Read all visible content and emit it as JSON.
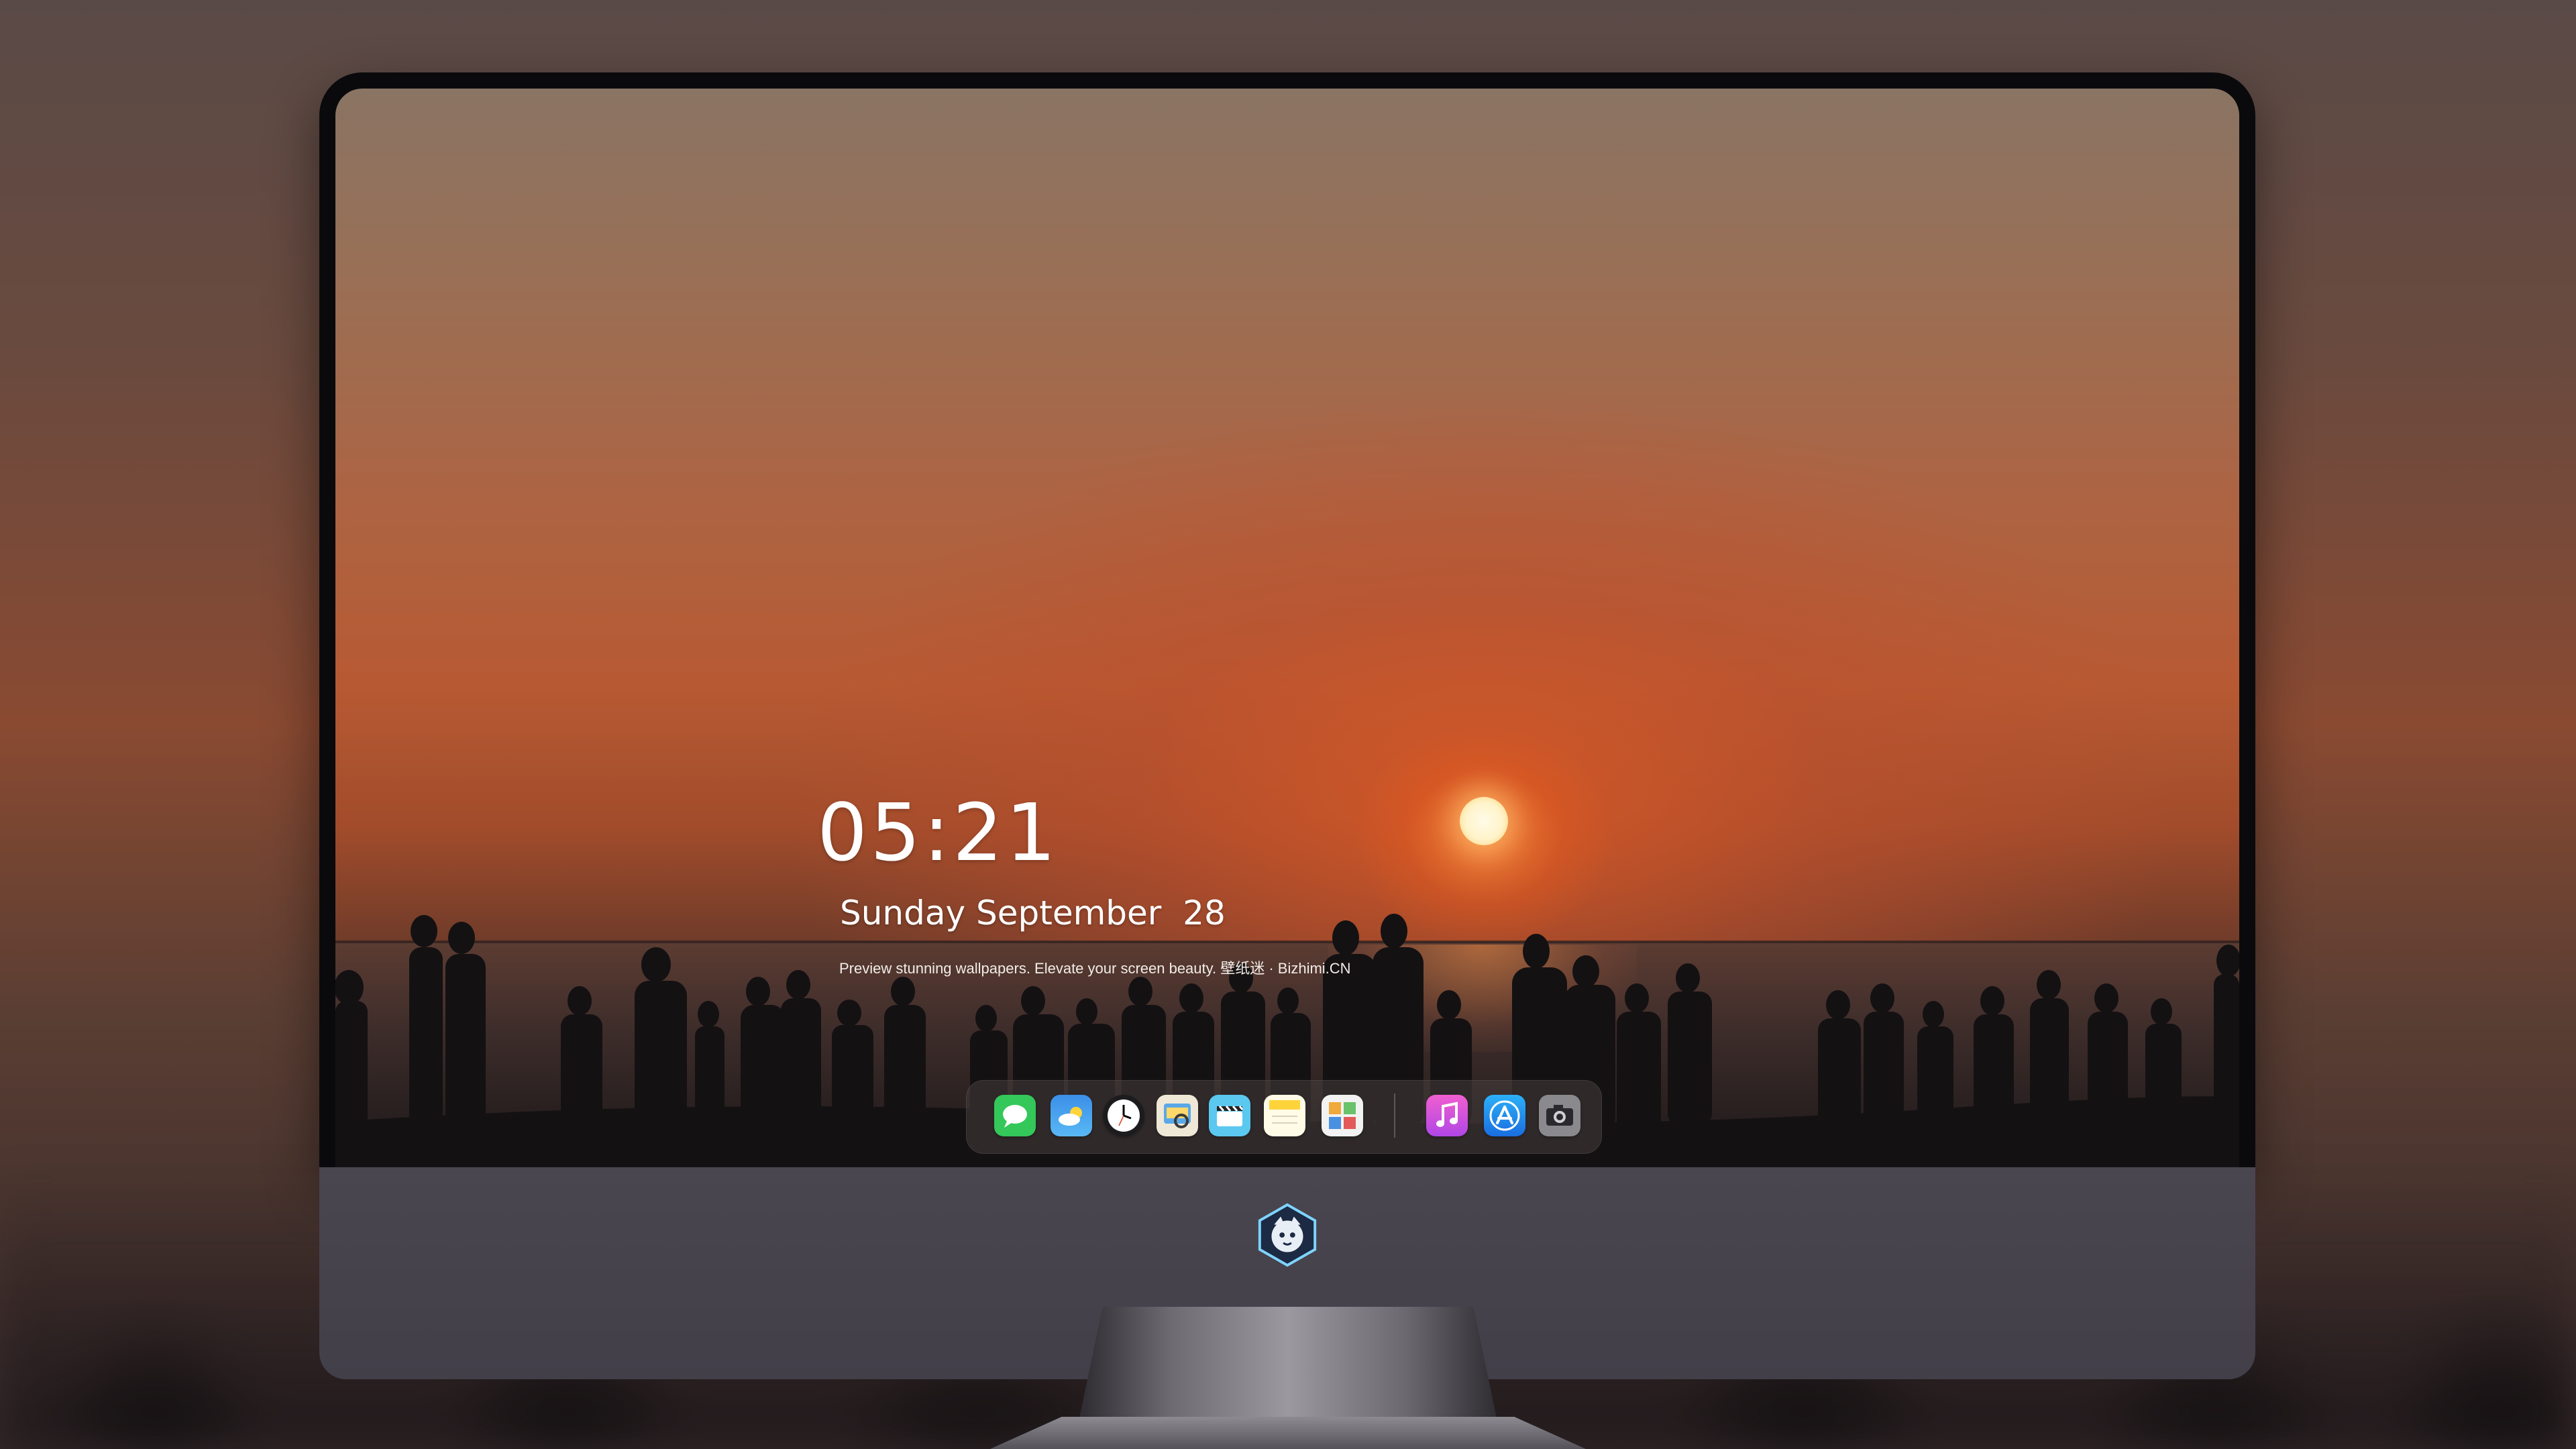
{
  "lock_screen": {
    "time": "05:21",
    "weekday": "Sunday",
    "month": "September",
    "day": "28",
    "date_display": "Sunday September  28",
    "tagline": "Preview stunning wallpapers. Elevate your screen beauty. 壁纸迷 · Bizhimi.CN"
  },
  "dock": {
    "apps": [
      {
        "name": "Messages",
        "icon": "messages-icon",
        "color": "#34c759"
      },
      {
        "name": "Weather",
        "icon": "weather-icon",
        "color": "#3a8eea"
      },
      {
        "name": "Clock",
        "icon": "clock-icon",
        "color": "#1c1c1e"
      },
      {
        "name": "Preview",
        "icon": "preview-icon",
        "color": "#e9e4d8"
      },
      {
        "name": "Clips",
        "icon": "clapperboard-icon",
        "color": "#5bc8f0"
      },
      {
        "name": "Notes",
        "icon": "notes-icon",
        "color": "#ffd43b"
      },
      {
        "name": "Photo Booth",
        "icon": "gallery-icon",
        "color": "#f2f2f2"
      },
      {
        "name": "iTunes",
        "icon": "music-note-icon",
        "color": "#d94ad3"
      },
      {
        "name": "App Store",
        "icon": "app-store-icon",
        "color": "#1a8ef0"
      },
      {
        "name": "Camera",
        "icon": "camera-icon",
        "color": "#8a8a8e"
      }
    ]
  },
  "monitor": {
    "logo": "mascot-logo-icon",
    "accent_colors": {
      "sky_top": "#8a7463",
      "sky_glow": "#d6582a",
      "sun": "#fff3c9",
      "chin": "#4a4650"
    }
  }
}
